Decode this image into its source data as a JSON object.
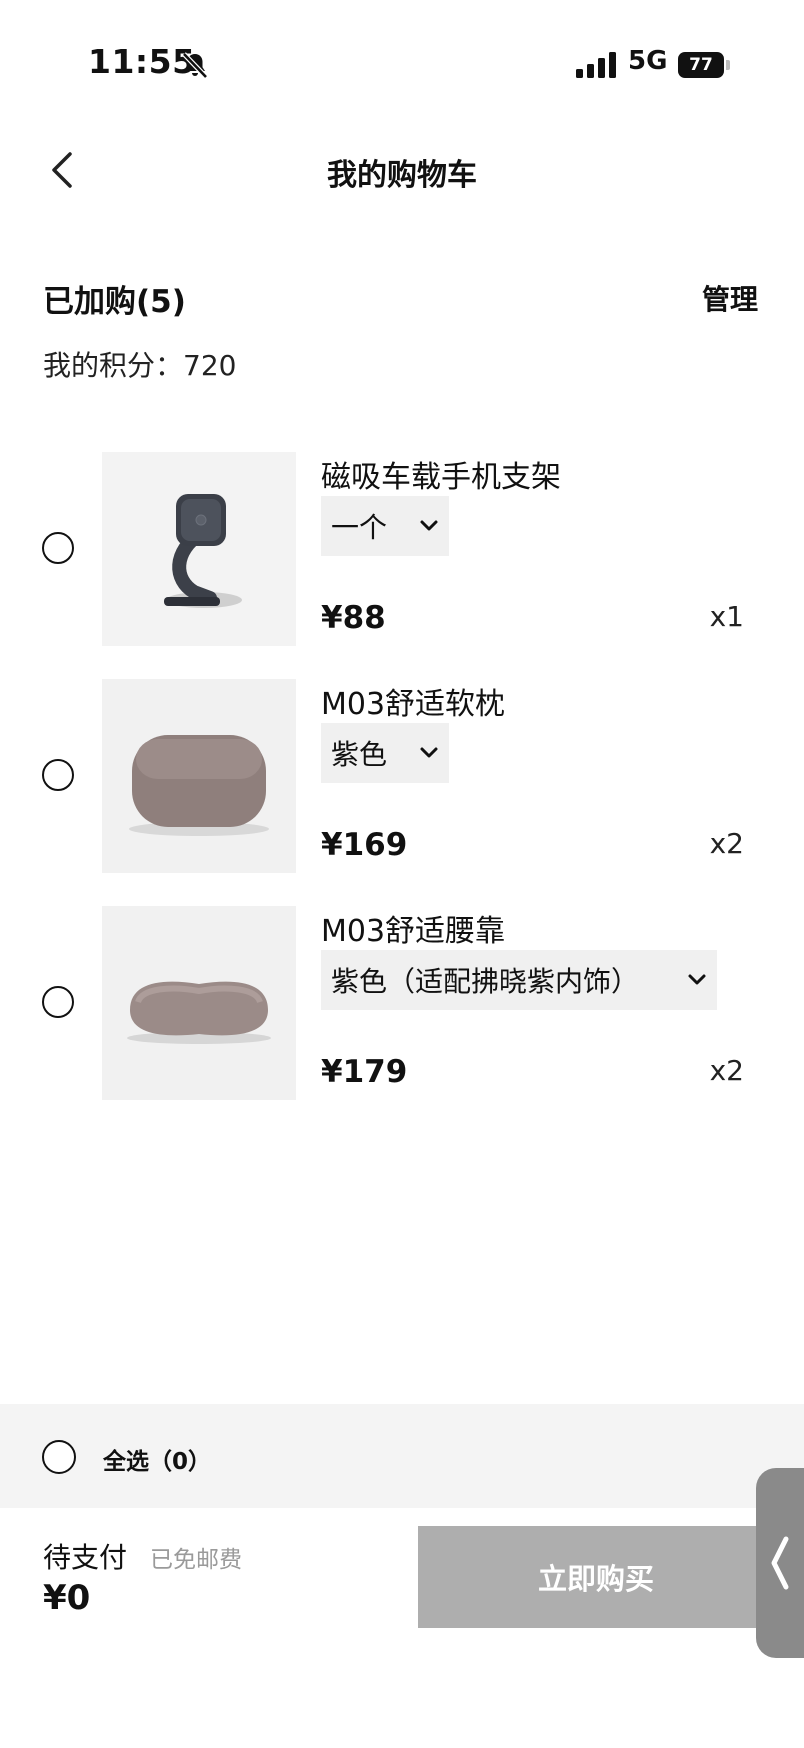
{
  "status_bar": {
    "time": "11:55",
    "network": "5G",
    "battery": "77"
  },
  "nav": {
    "title": "我的购物车"
  },
  "summary": {
    "added_label": "已加购(5)",
    "manage_label": "管理",
    "points_label": "我的积分：",
    "points_value": "720"
  },
  "items": [
    {
      "name": "磁吸车载手机支架",
      "variant": "一个",
      "price": "¥88",
      "qty": "x1"
    },
    {
      "name": "M03舒适软枕",
      "variant": "紫色",
      "price": "¥169",
      "qty": "x2"
    },
    {
      "name": "M03舒适腰靠",
      "variant": "紫色（适配拂晓紫内饰）",
      "price": "¥179",
      "qty": "x2"
    }
  ],
  "footer": {
    "select_all_label": "全选（0）",
    "pending_label": "待支付",
    "shipping_note": "已免邮费",
    "total": "¥0",
    "buy_label": "立即购买"
  }
}
